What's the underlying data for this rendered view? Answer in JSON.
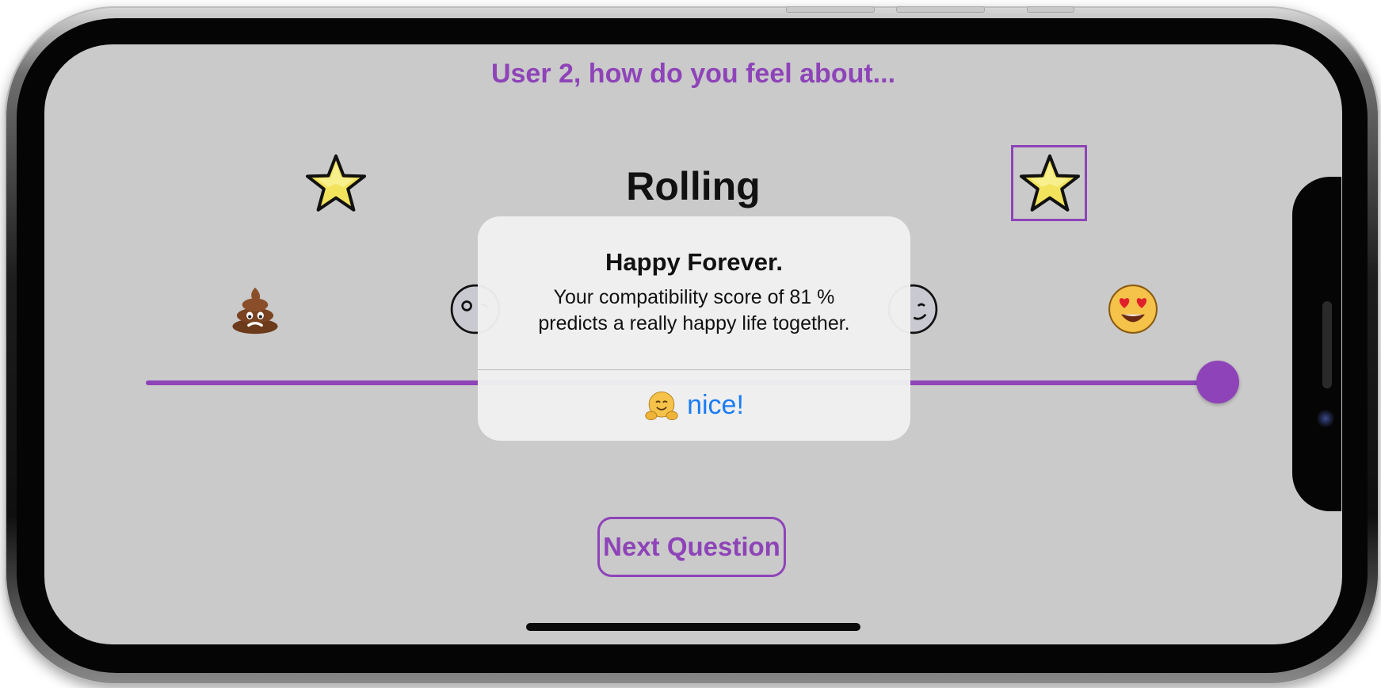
{
  "header": {
    "prompt": "User 2, how do you feel about..."
  },
  "question": {
    "word": "Rolling",
    "left_star_icon": "star-icon",
    "right_star_icon": "star-icon",
    "right_star_selected": true
  },
  "scale": {
    "icons": [
      "poop-icon",
      "frowning-face-icon",
      "smiling-face-icon",
      "heart-eyes-icon"
    ],
    "slider_value": 1.0,
    "accent_color": "#8e44b8"
  },
  "next_button": {
    "label": "Next Question"
  },
  "alert": {
    "title": "Happy Forever.",
    "message_line1": "Your compatibility score of 81 %",
    "message_line2": "predicts a really happy life together.",
    "action_icon": "hugging-face-icon",
    "action_label": "nice!",
    "action_color": "#1a7cf2"
  }
}
